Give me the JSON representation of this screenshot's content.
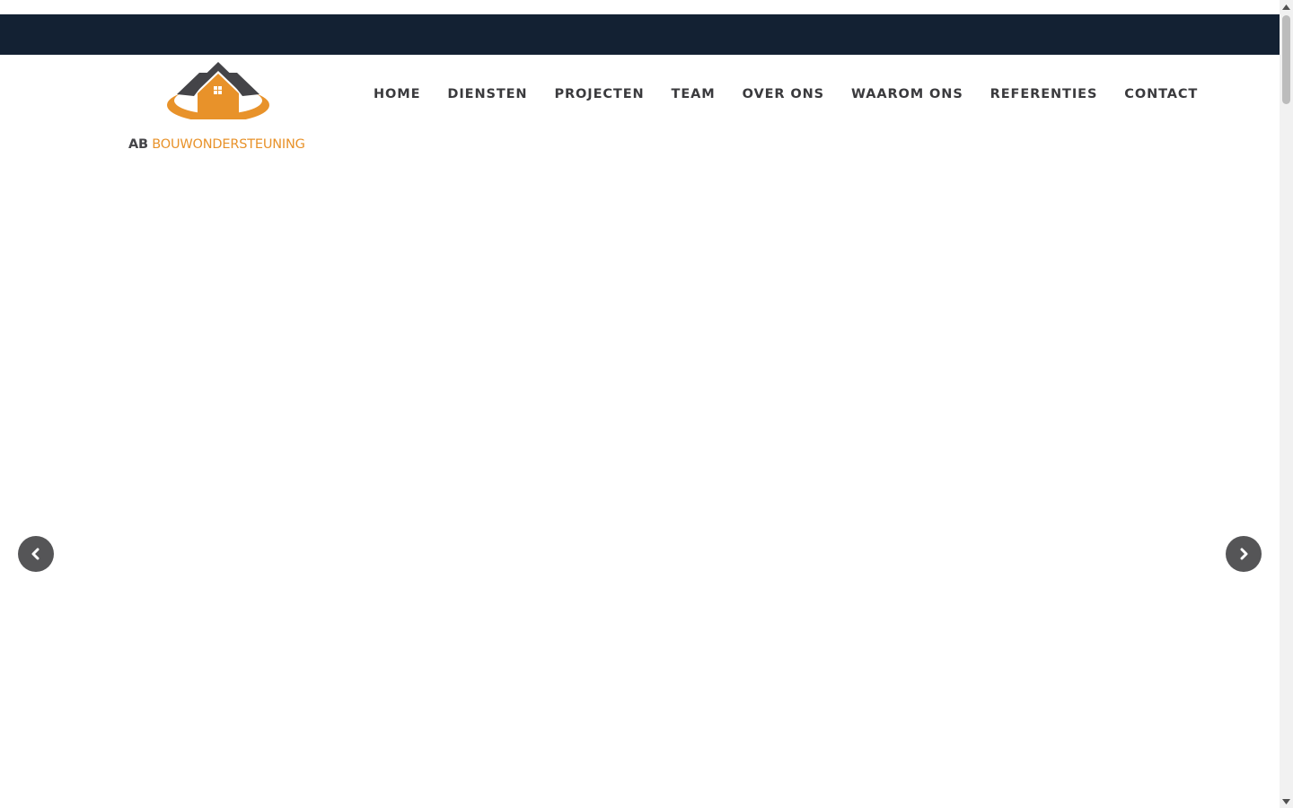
{
  "logo": {
    "prefix": "AB",
    "name": "BOUWONDERSTEUNING"
  },
  "nav": {
    "items": [
      {
        "label": "HOME"
      },
      {
        "label": "DIENSTEN"
      },
      {
        "label": "PROJECTEN"
      },
      {
        "label": "TEAM"
      },
      {
        "label": "OVER ONS"
      },
      {
        "label": "WAAROM ONS"
      },
      {
        "label": "REFERENTIES"
      },
      {
        "label": "CONTACT"
      }
    ]
  },
  "slider": {
    "prev_icon": "chevron-left-icon",
    "next_icon": "chevron-right-icon"
  },
  "colors": {
    "topbar": "#132133",
    "brand_orange": "#e8922a",
    "logo_dark": "#444448",
    "nav_text": "#3a3a3d",
    "arrow_bg": "#555557"
  }
}
